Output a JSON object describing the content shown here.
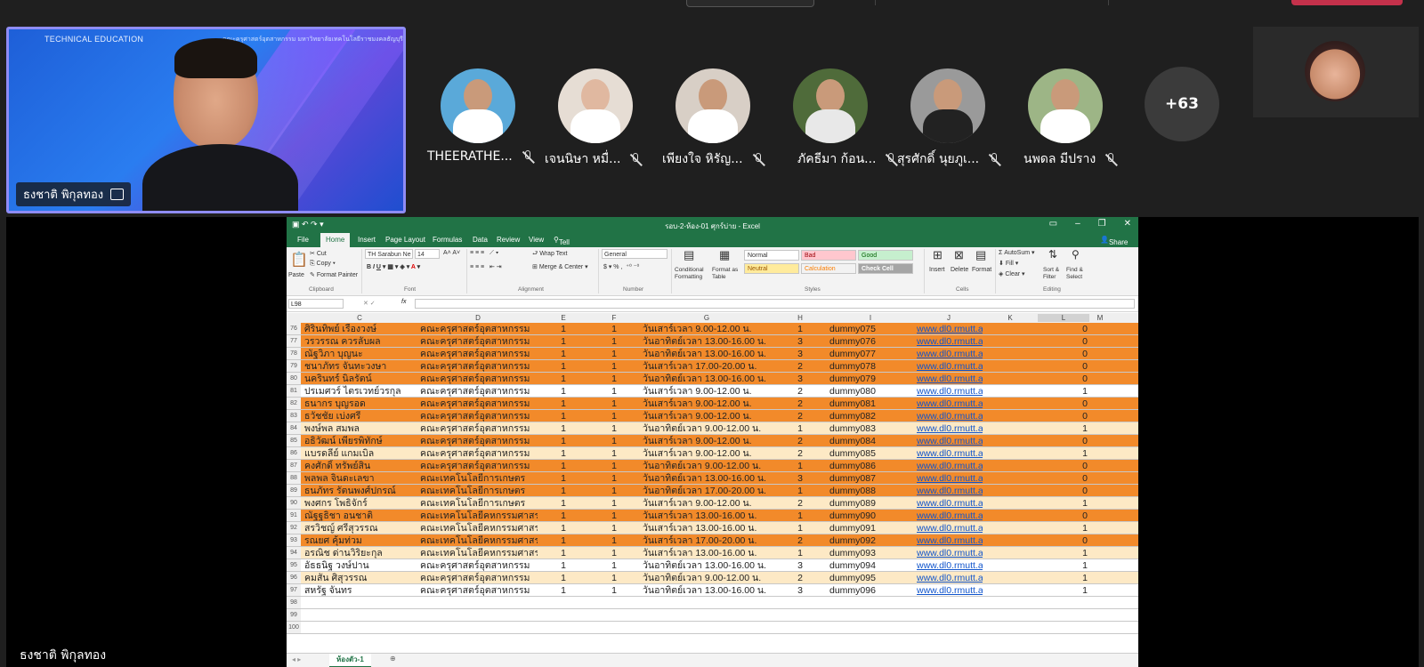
{
  "speaker": {
    "name": "ธงชาติ พิกุลทอง",
    "background_brand": "TECHNICAL EDUCATION",
    "background_subtitle": "คณะครุศาสตร์อุตสาหกรรม มหาวิทยาลัยเทคโนโลยีราชมงคลธัญบุรี"
  },
  "participants": [
    {
      "name": "THEERATHE..."
    },
    {
      "name": "เจนนิษา หมื่..."
    },
    {
      "name": "เพียงใจ หิรัญ..."
    },
    {
      "name": "ภัคธีมา ก้อน..."
    },
    {
      "name": "สุรศักดิ์ นุยภูเ..."
    },
    {
      "name": "นพดล มีปราง"
    }
  ],
  "more_count": "+63",
  "bottom_name": "ธงชาติ พิกุลทอง",
  "excel": {
    "title": "รอบ-2-ห้อง-01 ศุกร์บ่าย - Excel",
    "tabs": [
      "File",
      "Home",
      "Insert",
      "Page Layout",
      "Formulas",
      "Data",
      "Review",
      "View"
    ],
    "tell_me": "Tell me what you want to do...",
    "share": "Share",
    "font_name": "TH Sarabun Ne",
    "font_size": "14",
    "number_format": "General",
    "clipboard": {
      "cut": "Cut",
      "copy": "Copy",
      "format_painter": "Format Painter",
      "paste": "Paste"
    },
    "alignment": {
      "wrap": "Wrap Text",
      "merge": "Merge & Center"
    },
    "styles": {
      "normal": "Normal",
      "bad": "Bad",
      "good": "Good",
      "neutral": "Neutral",
      "calculation": "Calculation",
      "check_cell": "Check Cell"
    },
    "buttons": {
      "conditional": "Conditional Formatting",
      "format_table": "Format as Table",
      "insert": "Insert",
      "delete": "Delete",
      "format": "Format",
      "autosum": "AutoSum",
      "fill": "Fill",
      "clear": "Clear",
      "sort": "Sort & Filter",
      "find": "Find & Select"
    },
    "groups": [
      "Clipboard",
      "Font",
      "Alignment",
      "Number",
      "Styles",
      "Cells",
      "Editing"
    ],
    "name_box": "L98",
    "fx": "fx",
    "columns": [
      "C",
      "D",
      "E",
      "F",
      "G",
      "H",
      "I",
      "J",
      "K",
      "L",
      "M"
    ],
    "rows": [
      {
        "n": "76",
        "name": "ศิรินทิพย์ เรืองวงษ์",
        "fac": "คณะครุศาสตร์อุตสาหกรรม",
        "e": "1",
        "f": "1",
        "time": "วันเสาร์เวลา 9.00-12.00 น.",
        "h": "1",
        "user": "dummy075",
        "url": "www.dl0.rmutt.ac.th",
        "l": "0",
        "color": "orange"
      },
      {
        "n": "77",
        "name": "วรวรรณ ควรลับผล",
        "fac": "คณะครุศาสตร์อุตสาหกรรม",
        "e": "1",
        "f": "1",
        "time": "วันอาทิตย์เวลา 13.00-16.00 น.",
        "h": "3",
        "user": "dummy076",
        "url": "www.dl0.rmutt.ac.th",
        "l": "0",
        "color": "orange"
      },
      {
        "n": "78",
        "name": "ณัฐวิภา บุญนะ",
        "fac": "คณะครุศาสตร์อุตสาหกรรม",
        "e": "1",
        "f": "1",
        "time": "วันอาทิตย์เวลา 13.00-16.00 น.",
        "h": "3",
        "user": "dummy077",
        "url": "www.dl0.rmutt.ac.th",
        "l": "0",
        "color": "orange"
      },
      {
        "n": "79",
        "name": "ชนาภัทร จันทะวงษา",
        "fac": "คณะครุศาสตร์อุตสาหกรรม",
        "e": "1",
        "f": "1",
        "time": "วันเสาร์เวลา 17.00-20.00 น.",
        "h": "2",
        "user": "dummy078",
        "url": "www.dl0.rmutt.ac.th",
        "l": "0",
        "color": "orange"
      },
      {
        "n": "80",
        "name": "นครินทร์ นิลรัตน์",
        "fac": "คณะครุศาสตร์อุตสาหกรรม",
        "e": "1",
        "f": "1",
        "time": "วันอาทิตย์เวลา 13.00-16.00 น.",
        "h": "3",
        "user": "dummy079",
        "url": "www.dl0.rmutt.ac.th",
        "l": "0",
        "color": "orange"
      },
      {
        "n": "81",
        "name": "ปรเมศวร์ ไตรเวทย์วรกุล",
        "fac": "คณะครุศาสตร์อุตสาหกรรม",
        "e": "1",
        "f": "1",
        "time": "วันเสาร์เวลา 9.00-12.00 น.",
        "h": "2",
        "user": "dummy080",
        "url": "www.dl0.rmutt.ac.th",
        "l": "1",
        "color": "white"
      },
      {
        "n": "82",
        "name": "ธนากร บุญรอด",
        "fac": "คณะครุศาสตร์อุตสาหกรรม",
        "e": "1",
        "f": "1",
        "time": "วันเสาร์เวลา 9.00-12.00 น.",
        "h": "2",
        "user": "dummy081",
        "url": "www.dl0.rmutt.ac.th",
        "l": "0",
        "color": "orange"
      },
      {
        "n": "83",
        "name": "ธวัชชัย เบ่งศรี",
        "fac": "คณะครุศาสตร์อุตสาหกรรม",
        "e": "1",
        "f": "1",
        "time": "วันเสาร์เวลา 9.00-12.00 น.",
        "h": "2",
        "user": "dummy082",
        "url": "www.dl0.rmutt.ac.th",
        "l": "0",
        "color": "orange"
      },
      {
        "n": "84",
        "name": "พงษ์พล สมพล",
        "fac": "คณะครุศาสตร์อุตสาหกรรม",
        "e": "1",
        "f": "1",
        "time": "วันอาทิตย์เวลา 9.00-12.00 น.",
        "h": "1",
        "user": "dummy083",
        "url": "www.dl0.rmutt.ac.th",
        "l": "1",
        "color": "beige"
      },
      {
        "n": "85",
        "name": "อธิวัฒน์ เพียรพิทักษ์",
        "fac": "คณะครุศาสตร์อุตสาหกรรม",
        "e": "1",
        "f": "1",
        "time": "วันเสาร์เวลา 9.00-12.00 น.",
        "h": "2",
        "user": "dummy084",
        "url": "www.dl0.rmutt.ac.th",
        "l": "0",
        "color": "orange"
      },
      {
        "n": "86",
        "name": "แบรดลีย์ แกมเบิล",
        "fac": "คณะครุศาสตร์อุตสาหกรรม",
        "e": "1",
        "f": "1",
        "time": "วันเสาร์เวลา 9.00-12.00 น.",
        "h": "2",
        "user": "dummy085",
        "url": "www.dl0.rmutt.ac.th",
        "l": "1",
        "color": "beige"
      },
      {
        "n": "87",
        "name": "คงศักดิ์ ทรัพย์สิน",
        "fac": "คณะครุศาสตร์อุตสาหกรรม",
        "e": "1",
        "f": "1",
        "time": "วันอาทิตย์เวลา 9.00-12.00 น.",
        "h": "1",
        "user": "dummy086",
        "url": "www.dl0.rmutt.ac.th",
        "l": "0",
        "color": "orange"
      },
      {
        "n": "88",
        "name": "พลพล จินดะเลขา",
        "fac": "คณะเทคโนโลยีการเกษตร",
        "e": "1",
        "f": "1",
        "time": "วันอาทิตย์เวลา 13.00-16.00 น.",
        "h": "3",
        "user": "dummy087",
        "url": "www.dl0.rmutt.ac.th",
        "l": "0",
        "color": "orange"
      },
      {
        "n": "89",
        "name": "ธนภัทร รัตนพงศ์ปกรณ์",
        "fac": "คณะเทคโนโลยีการเกษตร",
        "e": "1",
        "f": "1",
        "time": "วันอาทิตย์เวลา 17.00-20.00 น.",
        "h": "1",
        "user": "dummy088",
        "url": "www.dl0.rmutt.ac.th",
        "l": "0",
        "color": "orange"
      },
      {
        "n": "90",
        "name": "พงศกร โพธิจักร์",
        "fac": "คณะเทคโนโลยีการเกษตร",
        "e": "1",
        "f": "1",
        "time": "วันเสาร์เวลา 9.00-12.00 น.",
        "h": "2",
        "user": "dummy089",
        "url": "www.dl0.rmutt.ac.th",
        "l": "1",
        "color": "beige"
      },
      {
        "n": "91",
        "name": "ณัฐฐธิชา อนชาติ",
        "fac": "คณะเทคโนโลยีคหกรรมศาสร",
        "e": "1",
        "f": "1",
        "time": "วันเสาร์เวลา 13.00-16.00 น.",
        "h": "1",
        "user": "dummy090",
        "url": "www.dl0.rmutt.ac.th",
        "l": "0",
        "color": "orange"
      },
      {
        "n": "92",
        "name": "สรวิชญ์ ศรีสุวรรณ",
        "fac": "คณะเทคโนโลยีคหกรรมศาสร",
        "e": "1",
        "f": "1",
        "time": "วันเสาร์เวลา 13.00-16.00 น.",
        "h": "1",
        "user": "dummy091",
        "url": "www.dl0.rmutt.ac.th",
        "l": "1",
        "color": "beige"
      },
      {
        "n": "93",
        "name": "รณยศ คุ้มท่วม",
        "fac": "คณะเทคโนโลยีคหกรรมศาสร",
        "e": "1",
        "f": "1",
        "time": "วันเสาร์เวลา 17.00-20.00 น.",
        "h": "2",
        "user": "dummy092",
        "url": "www.dl0.rmutt.ac.th",
        "l": "0",
        "color": "orange"
      },
      {
        "n": "94",
        "name": "อรณิช ด่านวิริยะกุล",
        "fac": "คณะเทคโนโลยีคหกรรมศาสร",
        "e": "1",
        "f": "1",
        "time": "วันเสาร์เวลา 13.00-16.00 น.",
        "h": "1",
        "user": "dummy093",
        "url": "www.dl0.rmutt.ac.th",
        "l": "1",
        "color": "beige"
      },
      {
        "n": "95",
        "name": "อัธธนิฐ วงษ์ปาน",
        "fac": "คณะครุศาสตร์อุตสาหกรรม",
        "e": "1",
        "f": "1",
        "time": "วันอาทิตย์เวลา 13.00-16.00 น.",
        "h": "3",
        "user": "dummy094",
        "url": "www.dl0.rmutt.ac.th",
        "l": "1",
        "color": "white"
      },
      {
        "n": "96",
        "name": "คมสัน ศิสุวรรณ",
        "fac": "คณะครุศาสตร์อุตสาหกรรม",
        "e": "1",
        "f": "1",
        "time": "วันอาทิตย์เวลา 9.00-12.00 น.",
        "h": "2",
        "user": "dummy095",
        "url": "www.dl0.rmutt.ac.th",
        "l": "1",
        "color": "beige"
      },
      {
        "n": "97",
        "name": "สหรัฐ จันทร",
        "fac": "คณะครุศาสตร์อุตสาหกรรม",
        "e": "1",
        "f": "1",
        "time": "วันอาทิตย์เวลา 13.00-16.00 น.",
        "h": "3",
        "user": "dummy096",
        "url": "www.dl0.rmutt.ac.th",
        "l": "1",
        "color": "white"
      },
      {
        "n": "98",
        "name": "",
        "fac": "",
        "e": "",
        "f": "",
        "time": "",
        "h": "",
        "user": "",
        "url": "",
        "l": "",
        "color": "white"
      },
      {
        "n": "99",
        "name": "",
        "fac": "",
        "e": "",
        "f": "",
        "time": "",
        "h": "",
        "user": "",
        "url": "",
        "l": "",
        "color": "white"
      },
      {
        "n": "100",
        "name": "",
        "fac": "",
        "e": "",
        "f": "",
        "time": "",
        "h": "",
        "user": "",
        "url": "",
        "l": "",
        "color": "white"
      }
    ],
    "sheet_tab": "ห้องตัว-1"
  }
}
